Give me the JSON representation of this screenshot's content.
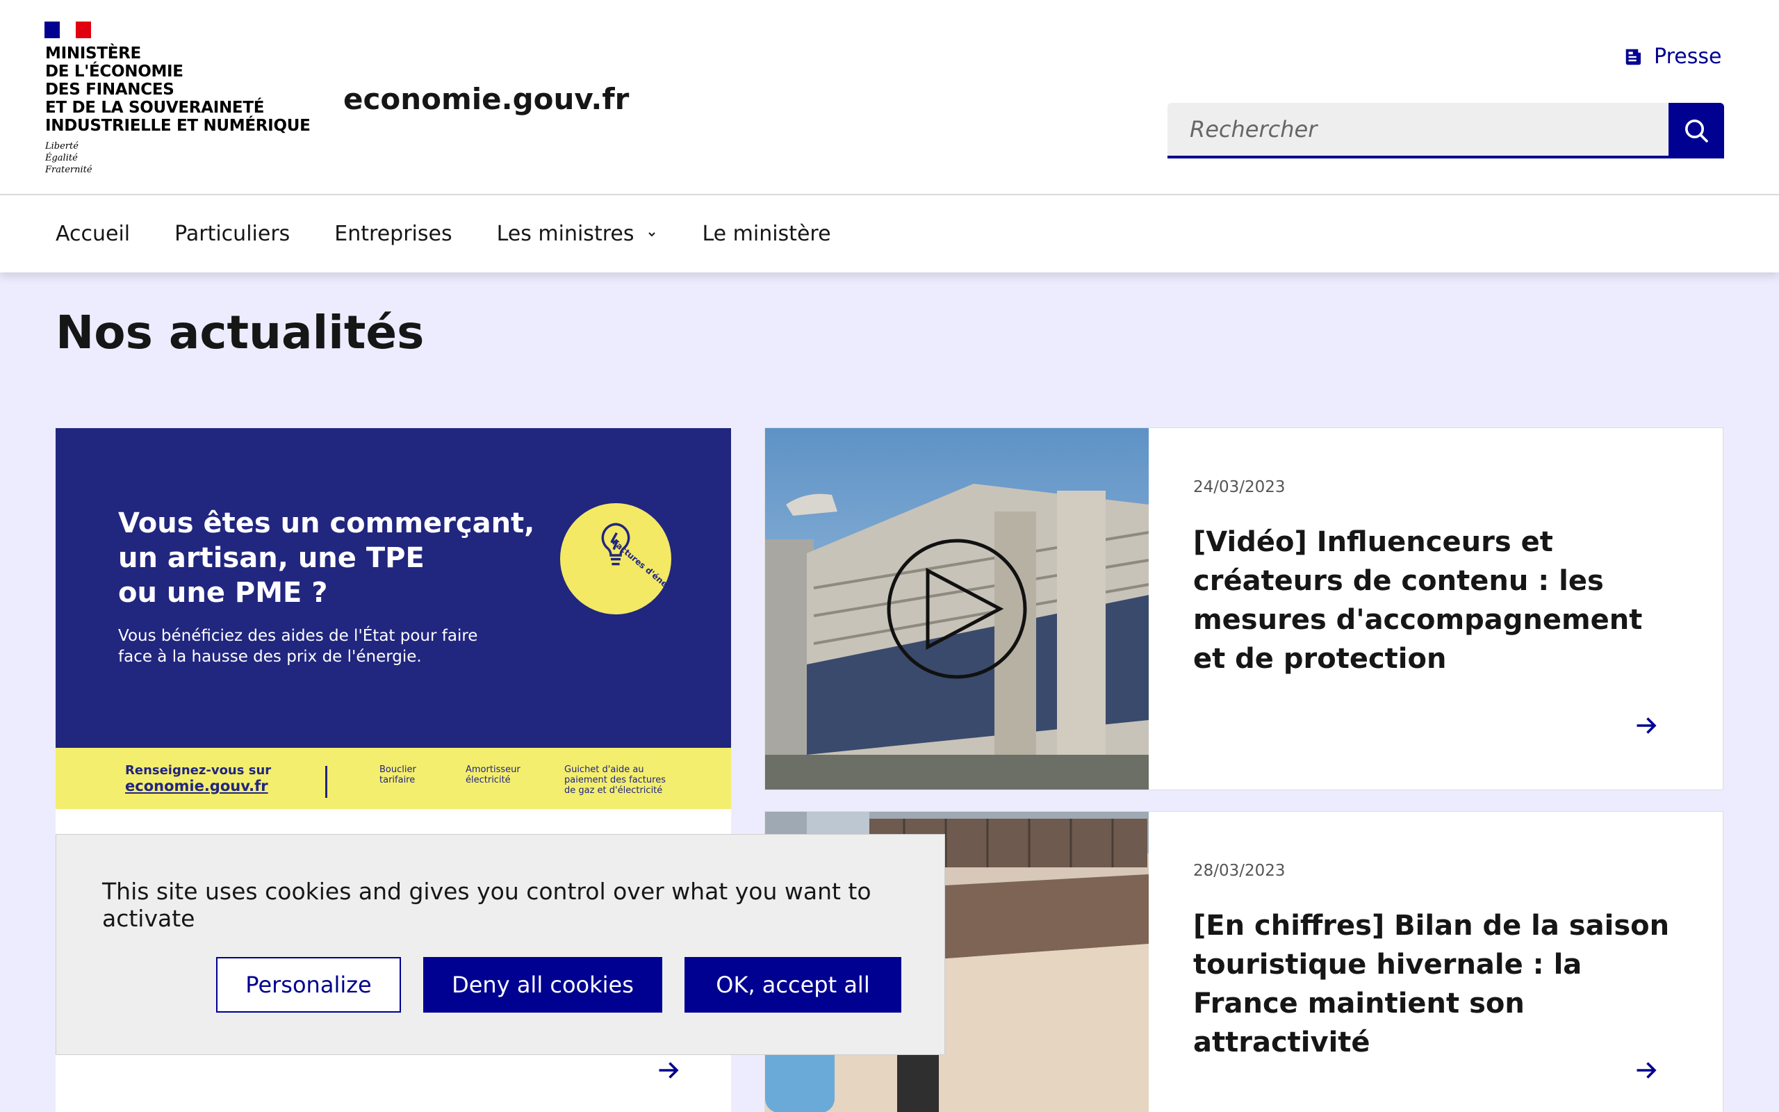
{
  "header": {
    "ministry_lines": [
      "MINISTÈRE",
      "DE L'ÉCONOMIE",
      "DES FINANCES",
      "ET DE LA SOUVERAINETÉ",
      "INDUSTRIELLE ET NUMÉRIQUE"
    ],
    "devise_lines": [
      "Liberté",
      "Égalité",
      "Fraternité"
    ],
    "site_name": "economie.gouv.fr",
    "presse_label": "Presse",
    "search_placeholder": "Rechercher"
  },
  "nav": {
    "items": [
      "Accueil",
      "Particuliers",
      "Entreprises",
      "Les ministres",
      "Le ministère"
    ]
  },
  "main": {
    "section_title": "Nos actualités",
    "featured": {
      "headline_lines": [
        "Vous êtes un commerçant,",
        "un artisan, une TPE",
        "ou une PME ?"
      ],
      "sub_lines": [
        "Vous bénéficiez des aides de l'État pour faire",
        "face à la hausse des prix de l'énergie."
      ],
      "badge_text": "Factures d'énergie",
      "footer_intro": "Renseignez-vous sur",
      "footer_link": "economie.gouv.fr",
      "footer_cols": [
        [
          "Bouclier",
          "tarifaire"
        ],
        [
          "Amortisseur",
          "électricité"
        ],
        [
          "Guichet d'aide au",
          "paiement des factures",
          "de gaz et d'électricité"
        ]
      ]
    },
    "cards": [
      {
        "date": "24/03/2023",
        "title": "[Vidéo] Influenceurs et créateurs de contenu : les mesures d'accompagnement et de protection"
      },
      {
        "date": "28/03/2023",
        "title": "[En chiffres] Bilan de la saison touristique hivernale : la France maintient son attractivité"
      }
    ]
  },
  "cookie_banner": {
    "message": "This site uses cookies and gives you control over what you want to activate",
    "personalize_label": "Personalize",
    "deny_label": "Deny all cookies",
    "accept_label": "OK, accept all"
  },
  "colors": {
    "primary_blue": "#000091",
    "background": "#ececfe",
    "banner_navy": "#21267f",
    "banner_yellow": "#f4ee6f",
    "flag_blue": "#000091",
    "flag_red": "#e1000f"
  },
  "icons": [
    "marianne-flag-logo",
    "newspaper-icon",
    "search-icon",
    "chevron-down-icon",
    "arrow-right-icon",
    "play-icon",
    "lightbulb-icon"
  ]
}
